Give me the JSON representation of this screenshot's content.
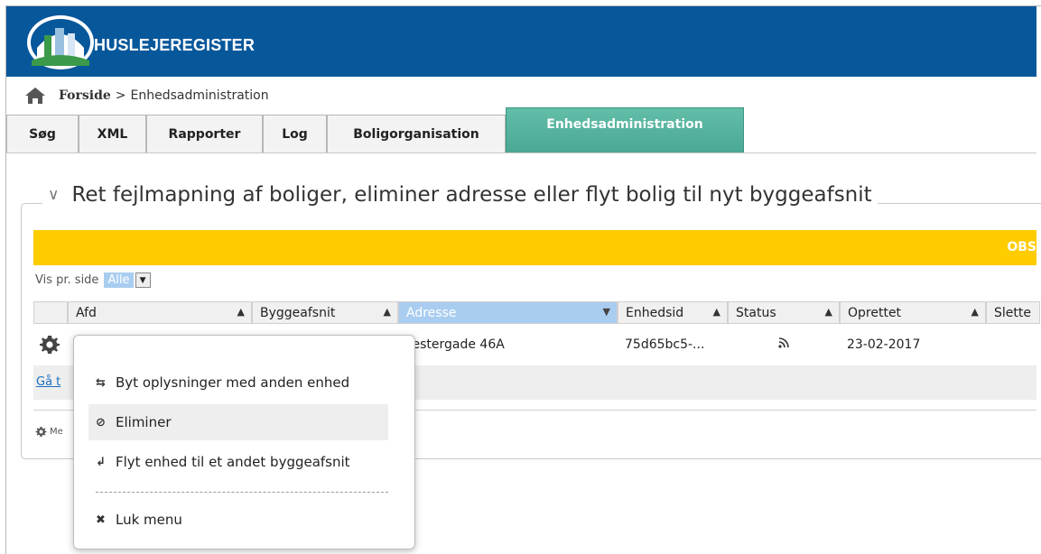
{
  "header": {
    "brand": "HUSLEJEREGISTER",
    "color": "#07579b"
  },
  "breadcrumb": {
    "home": "Forside",
    "separator": ">",
    "current": "Enhedsadministration"
  },
  "tabs": [
    {
      "label": "Søg"
    },
    {
      "label": "XML"
    },
    {
      "label": "Rapporter"
    },
    {
      "label": "Log"
    },
    {
      "label": "Boligorganisation"
    },
    {
      "label": "Enhedsadministration",
      "active": true
    }
  ],
  "panel": {
    "title": "Ret fejlmapning af boliger, eliminer adresse eller flyt bolig til nyt byggeafsnit",
    "notice": "OBS",
    "notice_color": "#ffcc00"
  },
  "pager": {
    "label": "Vis pr. side",
    "selected": "Alle"
  },
  "grid": {
    "columns": [
      "Afd",
      "Byggeafsnit",
      "Adresse",
      "Enhedsid",
      "Status",
      "Oprettet",
      "Slette"
    ],
    "row": {
      "adresse": "Vestergade 46A",
      "enhedsid": "75d65bc5-...",
      "status_icon": "rss-icon",
      "oprettet": "23-02-2017"
    },
    "goto_link": "Gå t",
    "menu_label": "Me"
  },
  "popup": {
    "items": [
      {
        "label": "Byt oplysninger med anden enhed",
        "icon": "swap-icon"
      },
      {
        "label": "Eliminer",
        "icon": "ban-icon"
      },
      {
        "label": "Flyt enhed til et andet byggeafsnit",
        "icon": "move-up-icon"
      },
      {
        "label": "Luk menu",
        "icon": "close-icon"
      }
    ]
  }
}
